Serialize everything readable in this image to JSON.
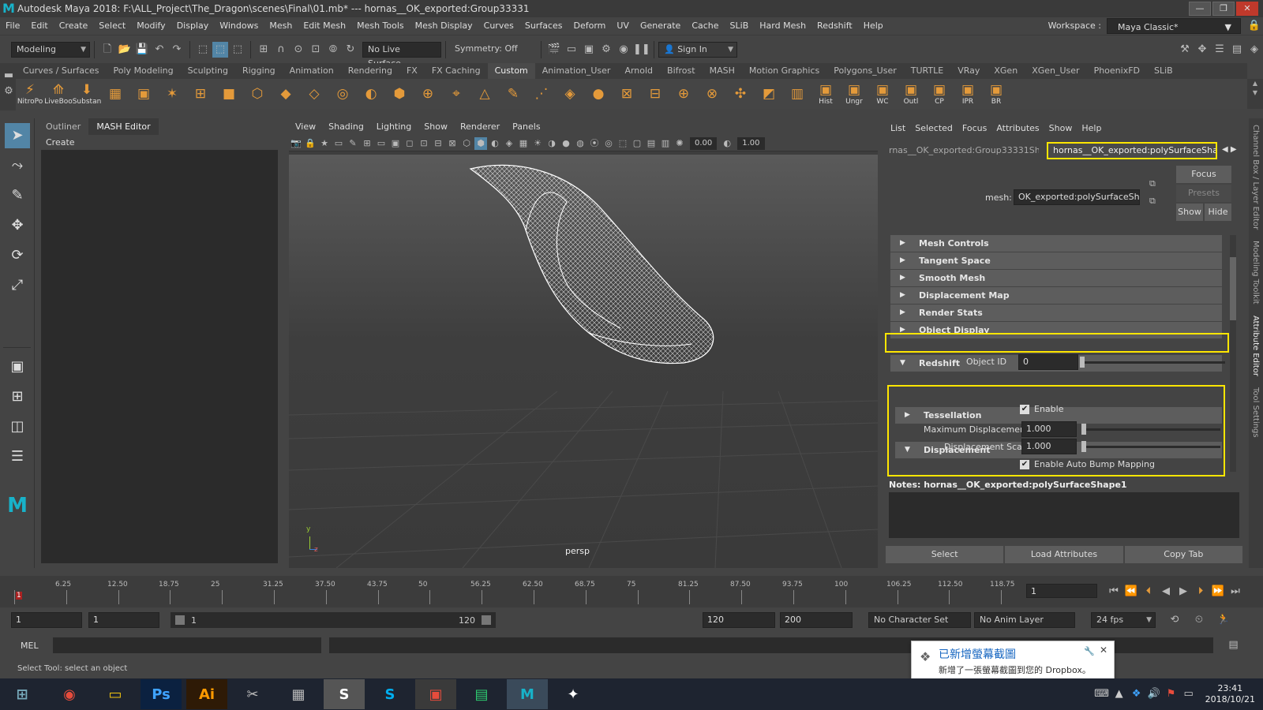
{
  "title": "Autodesk Maya 2018: F:\\ALL_Project\\The_Dragon\\scenes\\Final\\01.mb*  ---  hornas__OK_exported:Group33331",
  "window_buttons": [
    "—",
    "❐",
    "✕"
  ],
  "menu": [
    "File",
    "Edit",
    "Create",
    "Select",
    "Modify",
    "Display",
    "Windows",
    "Mesh",
    "Edit Mesh",
    "Mesh Tools",
    "Mesh Display",
    "Curves",
    "Surfaces",
    "Deform",
    "UV",
    "Generate",
    "Cache",
    "SLiB",
    "Hard Mesh",
    "Redshift",
    "Help"
  ],
  "workspace_label": "Workspace :",
  "workspace_value": "Maya Classic*",
  "mode_menu": "Modeling",
  "live_surface": "No Live Surface",
  "symmetry": "Symmetry: Off",
  "sign_in": "Sign In",
  "shelf_tabs": [
    "Curves / Surfaces",
    "Poly Modeling",
    "Sculpting",
    "Rigging",
    "Animation",
    "Rendering",
    "FX",
    "FX Caching",
    "Custom",
    "Animation_User",
    "Arnold",
    "Bifrost",
    "MASH",
    "Motion Graphics",
    "Polygons_User",
    "TURTLE",
    "VRay",
    "XGen",
    "XGen_User",
    "PhoenixFD",
    "SLiB"
  ],
  "shelf_active": "Custom",
  "shelf_icons": [
    {
      "label": "NitroPo"
    },
    {
      "label": "LiveBoo"
    },
    {
      "label": "Substan"
    },
    {
      "label": ""
    },
    {
      "label": ""
    },
    {
      "label": ""
    },
    {
      "label": ""
    },
    {
      "label": ""
    },
    {
      "label": ""
    },
    {
      "label": ""
    },
    {
      "label": ""
    },
    {
      "label": ""
    },
    {
      "label": ""
    },
    {
      "label": ""
    },
    {
      "label": ""
    },
    {
      "label": ""
    },
    {
      "label": ""
    },
    {
      "label": ""
    },
    {
      "label": ""
    },
    {
      "label": ""
    },
    {
      "label": ""
    },
    {
      "label": ""
    },
    {
      "label": ""
    },
    {
      "label": ""
    },
    {
      "label": ""
    },
    {
      "label": ""
    },
    {
      "label": ""
    },
    {
      "label": ""
    },
    {
      "label": "Hist"
    },
    {
      "label": "Ungr"
    },
    {
      "label": "WC"
    },
    {
      "label": "Outl"
    },
    {
      "label": "CP"
    },
    {
      "label": "IPR"
    },
    {
      "label": "BR"
    }
  ],
  "outliner": {
    "tabs": [
      "Outliner",
      "MASH Editor"
    ],
    "active": "MASH Editor",
    "menu": "Create"
  },
  "viewport": {
    "menu": [
      "View",
      "Shading",
      "Lighting",
      "Show",
      "Renderer",
      "Panels"
    ],
    "field_a": "0.00",
    "field_b": "1.00",
    "camera": "persp",
    "axis_y": "y",
    "axis_x": "z"
  },
  "ae": {
    "menu": [
      "List",
      "Selected",
      "Focus",
      "Attributes",
      "Show",
      "Help"
    ],
    "tab_left": "rnas__OK_exported:Group33331Shape",
    "tab_active": "hornas__OK_exported:polySurfaceShape1",
    "focus": "Focus",
    "presets": "Presets",
    "show": "Show",
    "hide": "Hide",
    "mesh_label": "mesh:",
    "mesh_value": "OK_exported:polySurfaceShape1",
    "sections": [
      "Mesh Controls",
      "Tangent Space",
      "Smooth Mesh",
      "Displacement Map",
      "Render Stats",
      "Object Display"
    ],
    "redshift": "Redshift",
    "object_id_label": "Object ID",
    "object_id_value": "0",
    "tessellation": "Tessellation",
    "displacement": "Displacement",
    "enable_label": "Enable",
    "max_disp_label": "Maximum Displacement",
    "max_disp_value": "1.000",
    "disp_scale_label": "Displacement Scale",
    "disp_scale_value": "1.000",
    "auto_bump_label": "Enable Auto Bump Mapping",
    "notes_label": "Notes:  hornas__OK_exported:polySurfaceShape1",
    "buttons": [
      "Select",
      "Load Attributes",
      "Copy Tab"
    ]
  },
  "side_tabs": [
    "Channel Box / Layer Editor",
    "Modeling Toolkit",
    "Attribute Editor",
    "Tool Settings"
  ],
  "timeline": {
    "ticks": [
      "6.25",
      "12.50",
      "18.75",
      "25",
      "31.25",
      "37.50",
      "43.75",
      "50",
      "56.25",
      "62.50",
      "68.75",
      "75",
      "81.25",
      "87.50",
      "93.75",
      "100",
      "106.25",
      "112.50",
      "118.75"
    ],
    "start_marker": "1",
    "current_frame": "1"
  },
  "range": {
    "start": "1",
    "start2": "1",
    "slider_start": "1",
    "slider_end": "120",
    "end": "120",
    "end2": "200",
    "char_set": "No Character Set",
    "anim_layer": "No Anim Layer",
    "fps": "24 fps"
  },
  "mel_label": "MEL",
  "help_line": "Select Tool: select an object",
  "toast": {
    "title": "已新增螢幕截圖",
    "body": "新增了一張螢幕截圖到您的 Dropbox。"
  },
  "taskbar": {
    "apps": [
      "Chrome",
      "Explorer",
      "Ps",
      "Ai",
      "Snipping",
      "Calculator",
      "Sublime",
      "Skype",
      "App",
      "Terminal",
      "Maya",
      "Motion"
    ],
    "time": "23:41",
    "date": "2018/10/21"
  },
  "colors": {
    "highlight": "#ffe600",
    "selected_tool": "#5285a6",
    "maya_teal": "#18b2c9"
  }
}
